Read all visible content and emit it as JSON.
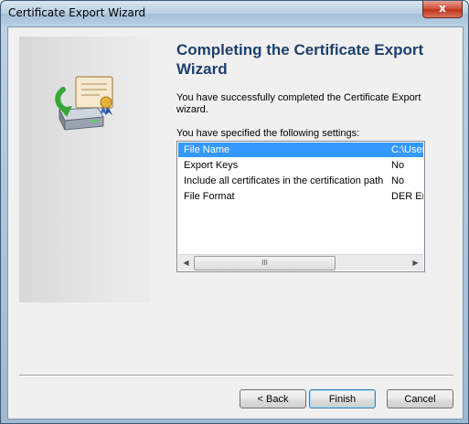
{
  "window": {
    "title": "Certificate Export Wizard",
    "close_glyph": "x"
  },
  "main": {
    "heading": "Completing the Certificate Export Wizard",
    "description": "You have successfully completed the Certificate Export wizard.",
    "settings_label": "You have specified the following settings:",
    "settings": [
      {
        "name": "File Name",
        "value": "C:\\Users",
        "selected": true
      },
      {
        "name": "Export Keys",
        "value": "No",
        "selected": false
      },
      {
        "name": "Include all certificates in the certification path",
        "value": "No",
        "selected": false
      },
      {
        "name": "File Format",
        "value": "DER Enc",
        "selected": false
      }
    ],
    "scroll_left_glyph": "◀",
    "scroll_right_glyph": "▶",
    "scroll_thumb_grip": "III"
  },
  "buttons": {
    "back": "< Back",
    "finish": "Finish",
    "cancel": "Cancel"
  },
  "icons": [
    "certificate-export-icon",
    "close-icon"
  ],
  "colors": {
    "heading": "#1e3f6e",
    "selection": "#3399ff"
  }
}
